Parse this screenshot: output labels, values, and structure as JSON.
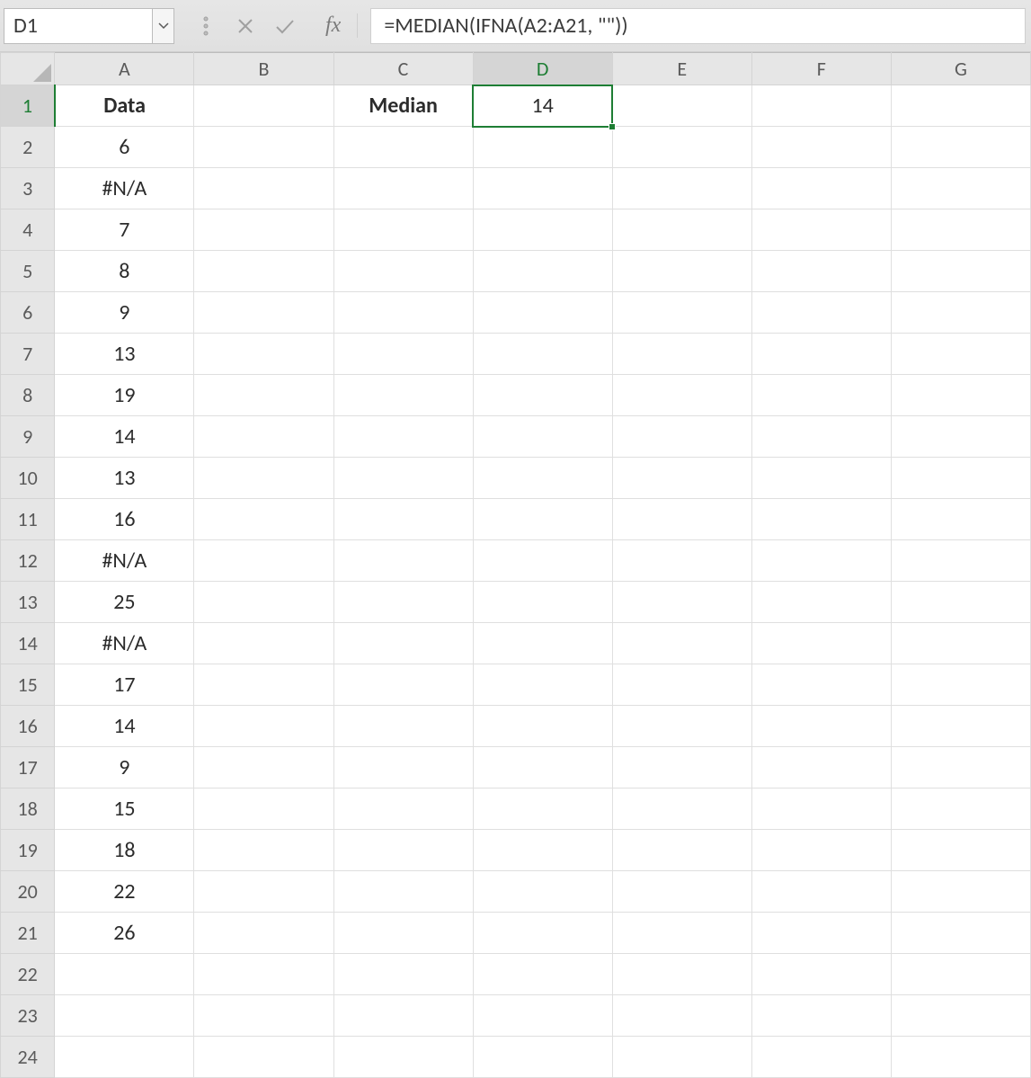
{
  "namebox": {
    "value": "D1"
  },
  "fx_label": "fx",
  "formula": "=MEDIAN(IFNA(A2:A21, \"\"))",
  "columns": [
    "A",
    "B",
    "C",
    "D",
    "E",
    "F",
    "G"
  ],
  "rows": [
    1,
    2,
    3,
    4,
    5,
    6,
    7,
    8,
    9,
    10,
    11,
    12,
    13,
    14,
    15,
    16,
    17,
    18,
    19,
    20,
    21,
    22,
    23,
    24
  ],
  "selected": {
    "col_index": 3,
    "row_index": 0,
    "ref": "D1"
  },
  "cells": {
    "A1": {
      "v": "Data",
      "bold": true,
      "align": "center"
    },
    "C1": {
      "v": "Median",
      "bold": true,
      "align": "left"
    },
    "D1": {
      "v": "14",
      "align": "right"
    },
    "A2": {
      "v": "6"
    },
    "A3": {
      "v": "#N/A"
    },
    "A4": {
      "v": "7"
    },
    "A5": {
      "v": "8"
    },
    "A6": {
      "v": "9"
    },
    "A7": {
      "v": "13"
    },
    "A8": {
      "v": "19"
    },
    "A9": {
      "v": "14"
    },
    "A10": {
      "v": "13"
    },
    "A11": {
      "v": "16"
    },
    "A12": {
      "v": "#N/A"
    },
    "A13": {
      "v": "25"
    },
    "A14": {
      "v": "#N/A"
    },
    "A15": {
      "v": "17"
    },
    "A16": {
      "v": "14"
    },
    "A17": {
      "v": "9"
    },
    "A18": {
      "v": "15"
    },
    "A19": {
      "v": "18"
    },
    "A20": {
      "v": "22"
    },
    "A21": {
      "v": "26"
    }
  }
}
